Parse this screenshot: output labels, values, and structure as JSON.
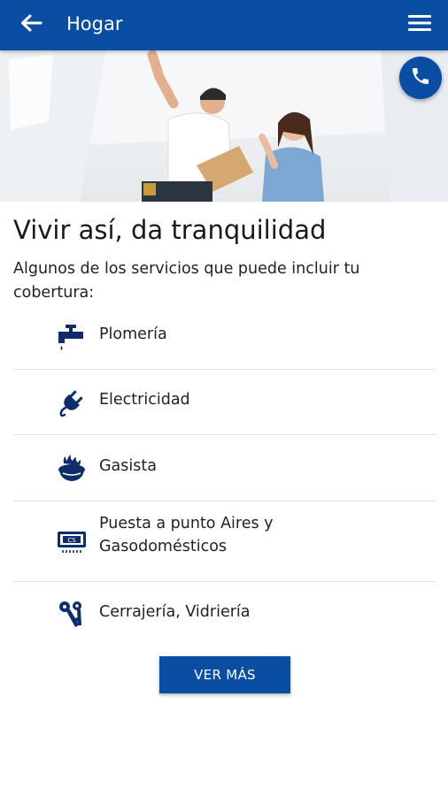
{
  "app_bar": {
    "title": "Hogar",
    "back_icon": "arrow-back-icon",
    "menu_icon": "hamburger-menu-icon",
    "background": "#0a4ea3"
  },
  "call_button": {
    "icon": "phone-icon"
  },
  "content": {
    "headline": "Vivir así, da tranquilidad",
    "intro": "Algunos de los servicios que puede incluir tu cobertura:"
  },
  "services": [
    {
      "label": "Plomería",
      "icon": "faucet-icon"
    },
    {
      "label": "Electricidad",
      "icon": "plug-icon"
    },
    {
      "label": "Gasista",
      "icon": "gas-burner-icon"
    },
    {
      "label": "Puesta a punto Aires y Gasodomésticos",
      "icon": "air-conditioner-icon"
    },
    {
      "label": "Cerrajería, Vidriería",
      "icon": "keys-icon"
    }
  ],
  "more_button": {
    "label": "VER MÁS"
  },
  "colors": {
    "brand_blue": "#0a4ea3",
    "icon_navy": "#0d2e6b"
  }
}
